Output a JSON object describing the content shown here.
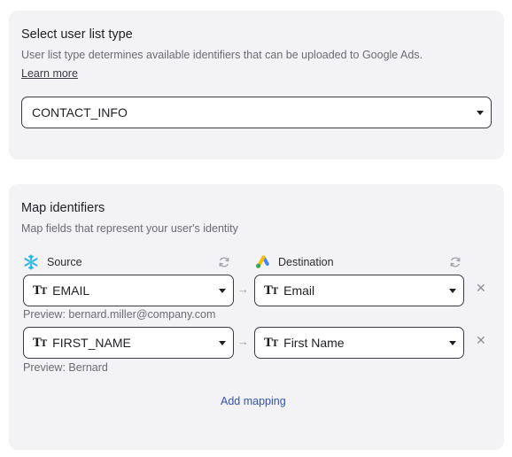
{
  "list_type": {
    "title": "Select user list type",
    "description": "User list type determines available identifiers that can be uploaded to Google Ads.",
    "learn_more": "Learn more",
    "selected": "CONTACT_INFO"
  },
  "map": {
    "title": "Map identifiers",
    "description": "Map fields that represent your user's identity",
    "source_label": "Source",
    "destination_label": "Destination",
    "rows": [
      {
        "source": "EMAIL",
        "destination": "Email",
        "preview": "Preview: bernard.miller@company.com"
      },
      {
        "source": "FIRST_NAME",
        "destination": "First Name",
        "preview": "Preview: Bernard"
      }
    ],
    "add_mapping": "Add mapping"
  },
  "icons": {
    "source": "snowflake-icon",
    "destination": "google-ads-icon",
    "refresh": "refresh-icon",
    "text_type": "text-type-icon",
    "remove": "close-icon",
    "arrow": "arrow-right-icon"
  },
  "colors": {
    "link": "#3453b3",
    "snowflake": "#29b5e8"
  }
}
